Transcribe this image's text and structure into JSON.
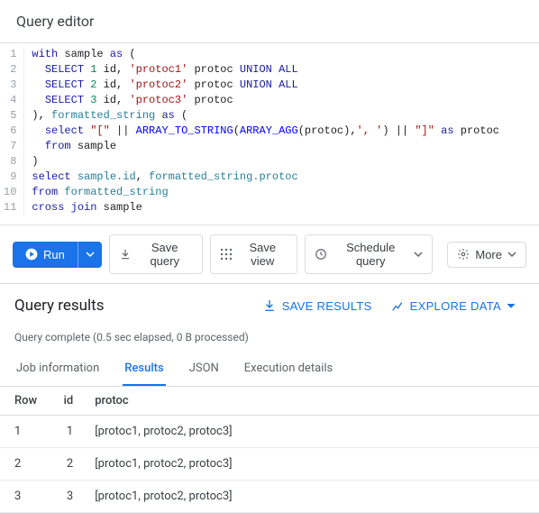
{
  "editor": {
    "title": "Query editor",
    "lines": [
      [
        {
          "t": "with",
          "c": "kw"
        },
        {
          "t": " sample "
        },
        {
          "t": "as",
          "c": "kw"
        },
        {
          "t": " ("
        }
      ],
      [
        {
          "t": "  "
        },
        {
          "t": "SELECT",
          "c": "kw"
        },
        {
          "t": " "
        },
        {
          "t": "1",
          "c": "num"
        },
        {
          "t": " id, "
        },
        {
          "t": "'protoc1'",
          "c": "str"
        },
        {
          "t": " protoc "
        },
        {
          "t": "UNION ALL",
          "c": "kw"
        }
      ],
      [
        {
          "t": "  "
        },
        {
          "t": "SELECT",
          "c": "kw"
        },
        {
          "t": " "
        },
        {
          "t": "2",
          "c": "num"
        },
        {
          "t": " id, "
        },
        {
          "t": "'protoc2'",
          "c": "str"
        },
        {
          "t": " protoc "
        },
        {
          "t": "UNION ALL",
          "c": "kw"
        }
      ],
      [
        {
          "t": "  "
        },
        {
          "t": "SELECT",
          "c": "kw"
        },
        {
          "t": " "
        },
        {
          "t": "3",
          "c": "num"
        },
        {
          "t": " id, "
        },
        {
          "t": "'protoc3'",
          "c": "str"
        },
        {
          "t": " protoc"
        }
      ],
      [
        {
          "t": "), "
        },
        {
          "t": "formatted_string",
          "c": "ident"
        },
        {
          "t": " "
        },
        {
          "t": "as",
          "c": "kw"
        },
        {
          "t": " ("
        }
      ],
      [
        {
          "t": "  "
        },
        {
          "t": "select",
          "c": "kw"
        },
        {
          "t": " "
        },
        {
          "t": "\"[\"",
          "c": "str"
        },
        {
          "t": " || "
        },
        {
          "t": "ARRAY_TO_STRING",
          "c": "func"
        },
        {
          "t": "("
        },
        {
          "t": "ARRAY_AGG",
          "c": "func"
        },
        {
          "t": "(protoc),"
        },
        {
          "t": "', '",
          "c": "str"
        },
        {
          "t": ") || "
        },
        {
          "t": "\"]\"",
          "c": "str"
        },
        {
          "t": " "
        },
        {
          "t": "as",
          "c": "kw"
        },
        {
          "t": " protoc"
        }
      ],
      [
        {
          "t": "  "
        },
        {
          "t": "from",
          "c": "kw"
        },
        {
          "t": " sample"
        }
      ],
      [
        {
          "t": ")"
        }
      ],
      [
        {
          "t": "select",
          "c": "kw"
        },
        {
          "t": " "
        },
        {
          "t": "sample.id",
          "c": "ident"
        },
        {
          "t": ", "
        },
        {
          "t": "formatted_string.protoc",
          "c": "ident"
        }
      ],
      [
        {
          "t": "from",
          "c": "kw"
        },
        {
          "t": " "
        },
        {
          "t": "formatted_string",
          "c": "ident"
        }
      ],
      [
        {
          "t": "cross join",
          "c": "kw"
        },
        {
          "t": " sample"
        }
      ]
    ]
  },
  "toolbar": {
    "run": "Run",
    "save_query": "Save query",
    "save_view": "Save view",
    "schedule": "Schedule query",
    "more": "More"
  },
  "results": {
    "title": "Query results",
    "save_results": "SAVE RESULTS",
    "explore_data": "EXPLORE DATA",
    "status": "Query complete (0.5 sec elapsed, 0 B processed)",
    "tabs": {
      "job_info": "Job information",
      "results": "Results",
      "json": "JSON",
      "exec": "Execution details"
    },
    "columns": [
      "Row",
      "id",
      "protoc"
    ],
    "rows": [
      {
        "row": "1",
        "id": "1",
        "protoc": "[protoc1, protoc2, protoc3]"
      },
      {
        "row": "2",
        "id": "2",
        "protoc": "[protoc1, protoc2, protoc3]"
      },
      {
        "row": "3",
        "id": "3",
        "protoc": "[protoc1, protoc2, protoc3]"
      }
    ]
  }
}
